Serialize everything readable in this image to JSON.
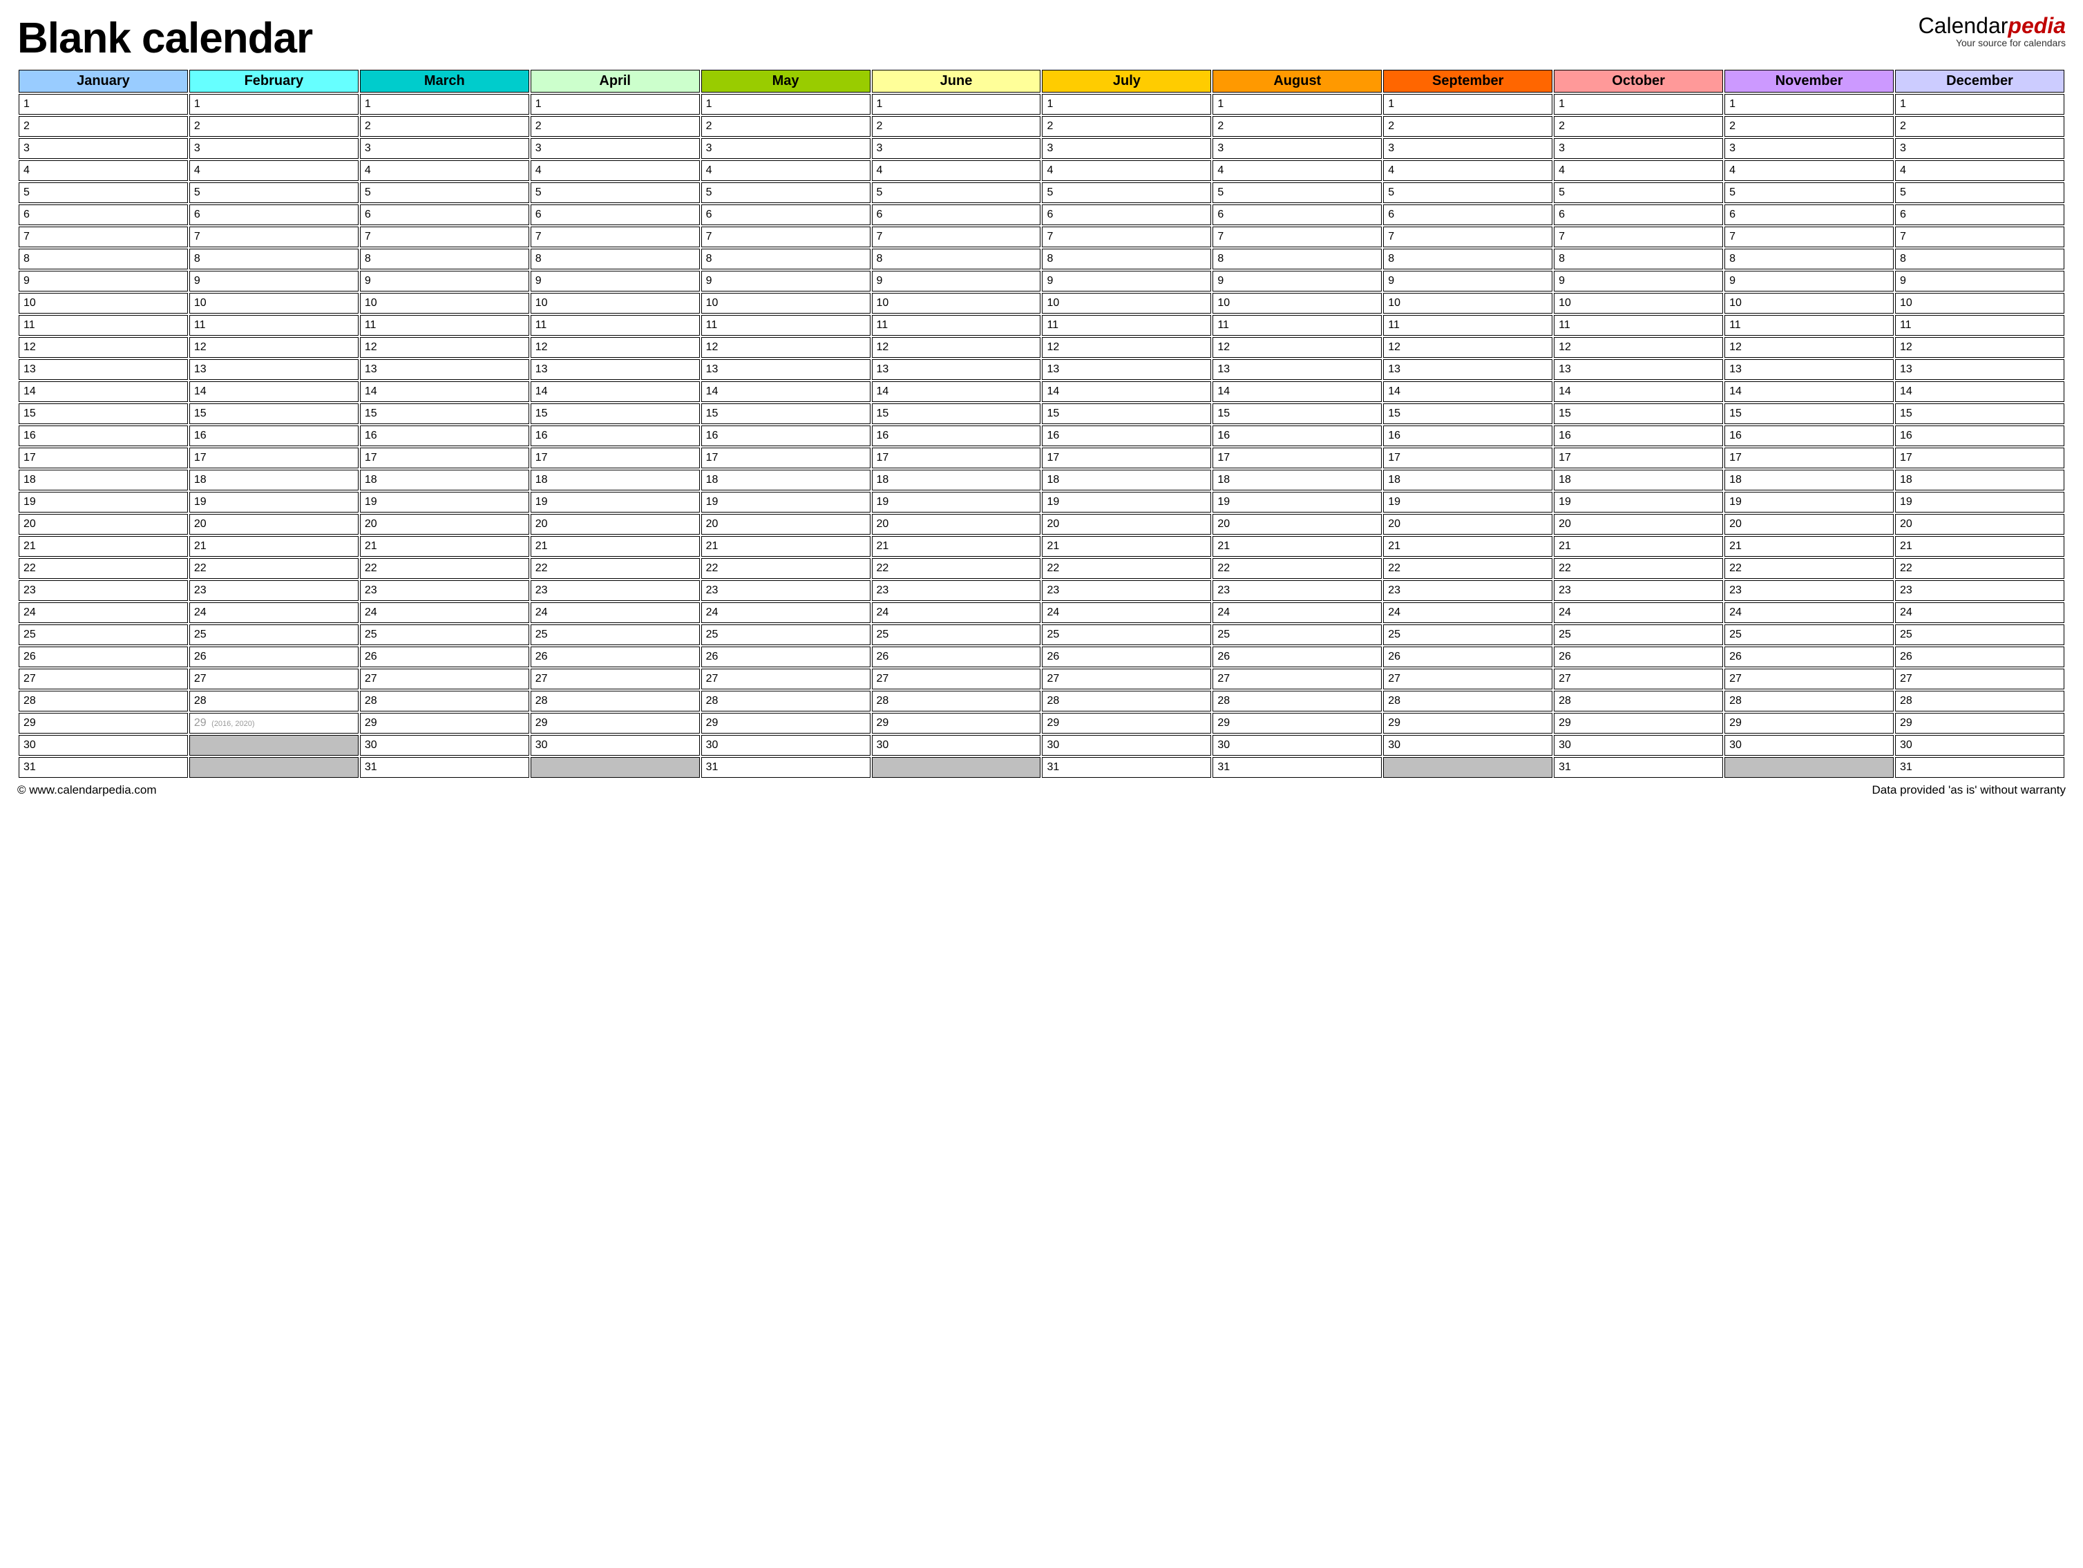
{
  "header": {
    "title": "Blank calendar",
    "brand_prefix": "Calendar",
    "brand_suffix": "pedia",
    "brand_tagline": "Your source for calendars"
  },
  "months": [
    {
      "name": "January",
      "color": "#99ccff",
      "days": 31
    },
    {
      "name": "February",
      "color": "#66ffff",
      "days": 28,
      "leap": {
        "day": 29,
        "note": "(2016, 2020)"
      }
    },
    {
      "name": "March",
      "color": "#00cccc",
      "days": 31
    },
    {
      "name": "April",
      "color": "#ccffcc",
      "days": 30
    },
    {
      "name": "May",
      "color": "#99cc00",
      "days": 31
    },
    {
      "name": "June",
      "color": "#ffff99",
      "days": 30
    },
    {
      "name": "July",
      "color": "#ffcc00",
      "days": 31
    },
    {
      "name": "August",
      "color": "#ff9900",
      "days": 31
    },
    {
      "name": "September",
      "color": "#ff6600",
      "days": 30
    },
    {
      "name": "October",
      "color": "#ff9999",
      "days": 31
    },
    {
      "name": "November",
      "color": "#cc99ff",
      "days": 30
    },
    {
      "name": "December",
      "color": "#ccccff",
      "days": 31
    }
  ],
  "max_rows": 31,
  "footer": {
    "left": "© www.calendarpedia.com",
    "right": "Data provided 'as is' without warranty"
  }
}
